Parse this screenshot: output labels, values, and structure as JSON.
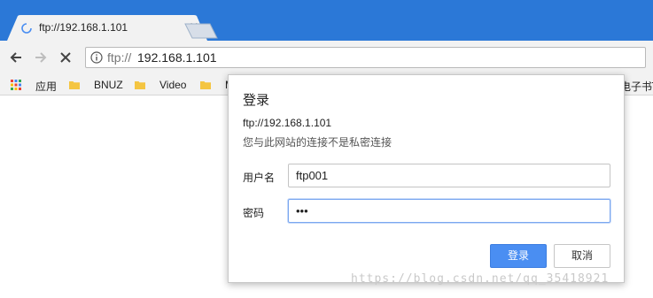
{
  "tab": {
    "title": "ftp://192.168.1.101",
    "close_glyph": "×",
    "loading_icon": "spinner-icon"
  },
  "toolbar": {
    "url_scheme": "ftp://",
    "url_host": "192.168.1.101"
  },
  "bookmarks": {
    "items": [
      {
        "label": "应用",
        "icon": "apps-grid-icon"
      },
      {
        "label": "BNUZ",
        "icon": "folder-icon"
      },
      {
        "label": "Video",
        "icon": "folder-icon"
      },
      {
        "label": "M",
        "icon": "folder-icon"
      }
    ],
    "right_text": "电子书T"
  },
  "dialog": {
    "title": "登录",
    "host": "ftp://192.168.1.101",
    "warning": "您与此网站的连接不是私密连接",
    "username_label": "用户名",
    "username_value": "ftp001",
    "password_label": "密码",
    "password_value": "•••",
    "login_button": "登录",
    "cancel_button": "取消"
  },
  "watermark": "https://blog.csdn.net/qq_35418921",
  "colors": {
    "titlebar": "#2b78d7",
    "toolbar": "#f2f2f2",
    "primary_button": "#4a8ef2",
    "folder": "#f4c542"
  }
}
